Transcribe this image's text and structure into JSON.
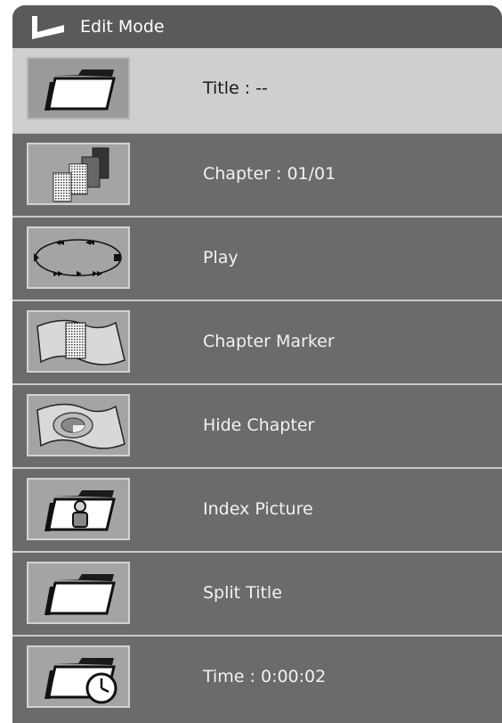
{
  "header": {
    "title": "Edit Mode",
    "icon": "return-arrow-icon"
  },
  "menu": {
    "items": [
      {
        "name": "title",
        "label": "Title : --",
        "icon": "folder-icon",
        "selected": true
      },
      {
        "name": "chapter",
        "label": "Chapter : 01/01",
        "icon": "chapter-icon",
        "selected": false
      },
      {
        "name": "play",
        "label": "Play",
        "icon": "play-cycle-icon",
        "selected": false
      },
      {
        "name": "chapter-marker",
        "label": "Chapter Marker",
        "icon": "chapter-marker-icon",
        "selected": false
      },
      {
        "name": "hide-chapter",
        "label": "Hide Chapter",
        "icon": "hide-chapter-icon",
        "selected": false
      },
      {
        "name": "index-picture",
        "label": "Index Picture",
        "icon": "index-picture-icon",
        "selected": false
      },
      {
        "name": "split-title",
        "label": "Split Title",
        "icon": "folder-icon",
        "selected": false
      },
      {
        "name": "time",
        "label": "Time : 0:00:02",
        "icon": "folder-clock-icon",
        "selected": false
      }
    ]
  },
  "colors": {
    "panel": "#6b6b6b",
    "header": "#5a5a5a",
    "selected_row": "#cfcfcf",
    "separator": "#c9c9c9"
  }
}
